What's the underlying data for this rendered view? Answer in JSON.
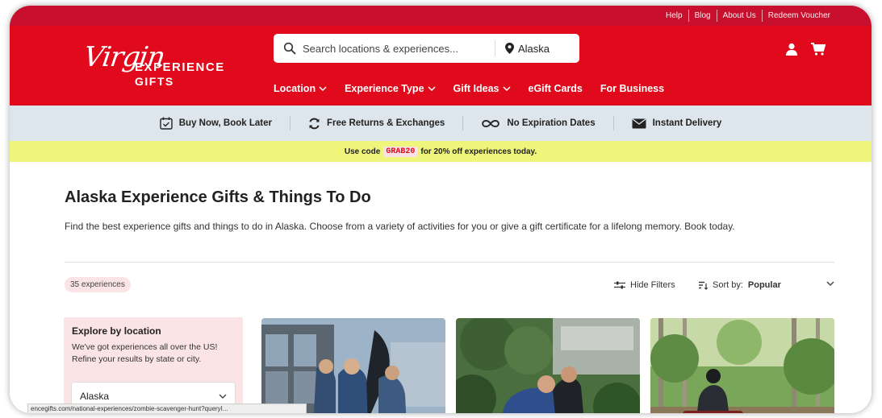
{
  "utility_links": [
    "Help",
    "Blog",
    "About Us",
    "Redeem Voucher"
  ],
  "logo": {
    "script": "Virgin",
    "line1": "EXPERIENCE",
    "line2": "GIFTS"
  },
  "search": {
    "placeholder": "Search locations & experiences...",
    "location": "Alaska"
  },
  "nav": {
    "location": "Location",
    "experience_type": "Experience Type",
    "gift_ideas": "Gift Ideas",
    "egift": "eGift Cards",
    "business": "For Business"
  },
  "benefits": {
    "buy_now": "Buy Now, Book Later",
    "returns": "Free Returns & Exchanges",
    "no_expiration": "No Expiration Dates",
    "delivery": "Instant Delivery"
  },
  "promo": {
    "prefix": "Use code",
    "code": "GRAB20",
    "suffix": "for 20% off experiences today."
  },
  "page": {
    "title": "Alaska Experience Gifts & Things To Do",
    "description": "Find the best experience gifts and things to do in Alaska. Choose from a variety of activities for you or give a gift certificate for a lifelong memory. Book today."
  },
  "toolbar": {
    "count": "35 experiences",
    "hide_filters": "Hide Filters",
    "sort_label": "Sort by:",
    "sort_value": "Popular"
  },
  "explore": {
    "title": "Explore by location",
    "subtitle": "We've got experiences all over the US! Refine your results by state or city.",
    "selected": "Alaska"
  },
  "statusbar": "encegifts.com/national-experiences/zombie-scavenger-hunt?queryI...",
  "colors": {
    "brand_red": "#e10a1c",
    "benefit_bar": "#dce6ec",
    "promo_bar": "#eef57a",
    "pink_panel": "#fbe4e6"
  }
}
